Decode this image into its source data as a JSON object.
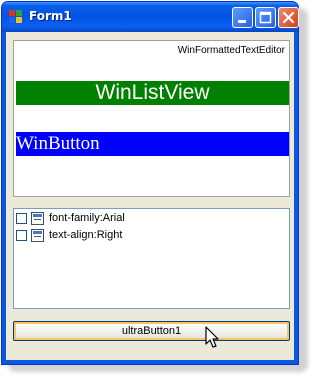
{
  "window": {
    "title": "Form1"
  },
  "title_buttons": {
    "minimize_icon": "minimize-icon",
    "maximize_icon": "maximize-icon",
    "close_icon": "close-icon"
  },
  "panel": {
    "formatted_editor_label": "WinFormattedTextEditor",
    "listview_label": "WinListView",
    "listview_color": "#008000",
    "button_label": "WinButton",
    "button_color": "#0000ff"
  },
  "listbox": {
    "items": [
      {
        "label": "font-family:Arial",
        "checked": false
      },
      {
        "label": "text-align:Right",
        "checked": false
      }
    ]
  },
  "ultra_button": {
    "label": "ultraButton1"
  }
}
